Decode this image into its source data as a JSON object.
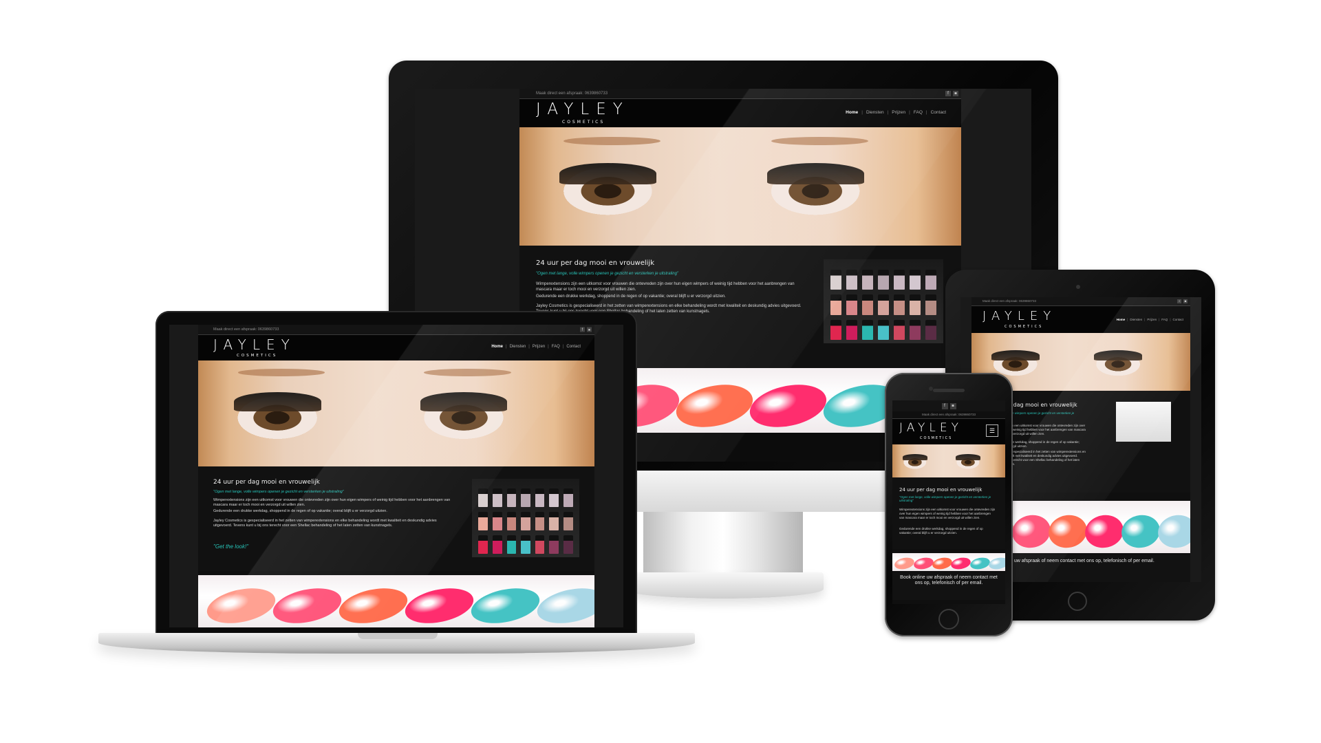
{
  "site": {
    "topbar_text": "Maak direct een afspraak: 0639860733",
    "social": {
      "facebook_glyph": "f",
      "instagram_glyph": "◙"
    },
    "logo": "JAYLEY",
    "logo_sub": "COSMETICS",
    "nav": [
      "Home",
      "Diensten",
      "Prijzen",
      "FAQ",
      "Contact"
    ],
    "nav_separator": "|",
    "heading": "24 uur per dag mooi en vrouwelijk",
    "quote": "\"Ogen met lange, volle wimpers openen je gezicht en versterken je uitstraling\"",
    "body1": "Wimperextensions zijn een uitkomst voor vrouwen die ontevreden zijn over hun eigen wimpers of weinig tijd hebben voor het aanbrengen van mascara maar er toch mooi en verzorgd uit willen zien.",
    "body2": "Gedurende een drukke werkdag, shoppend in de regen of op vakantie; overal blijft u er verzorgd uitzien.",
    "body3": "Jayley Cosmetics is gespecialiseerd in het zetten van wimperextensions en elke behandeling wordt met kwaliteit en deskundig advies uitgevoerd. Tevens kunt u bij ons terecht voor een Shellac behandeling of het laten zetten van kunstnagels.",
    "tagline": "\"Get the look!\"",
    "booking": "Book online uw afspraak of neem contact met ons op, telefonisch of per email.",
    "booking_tablet": "ne uw afspraak of neem contact met ons op, telefonisch of per email."
  },
  "colors": {
    "accent": "#27c3b8",
    "background": "#111111",
    "header": "#050505"
  },
  "polish_colors": [
    [
      "#d8cfcf",
      "#cdbfc6",
      "#c6b4bc",
      "#b7a7b0",
      "#c9b8c2",
      "#d3c7cf",
      "#beaab6"
    ],
    [
      "#e9a99a",
      "#d8868a",
      "#c9877e",
      "#d4a39c",
      "#c58f86",
      "#d9b2a7",
      "#b48c84"
    ],
    [
      "#e0264f",
      "#cf1d5c",
      "#2bb7b0",
      "#49c0c8",
      "#d0485f",
      "#8e3b5e",
      "#5a2c45"
    ]
  ],
  "nail_colors": [
    "#ff9a8a",
    "#ff4f76",
    "#ff6a4a",
    "#ff2d6e",
    "#45c3c4",
    "#a9d7e6"
  ]
}
